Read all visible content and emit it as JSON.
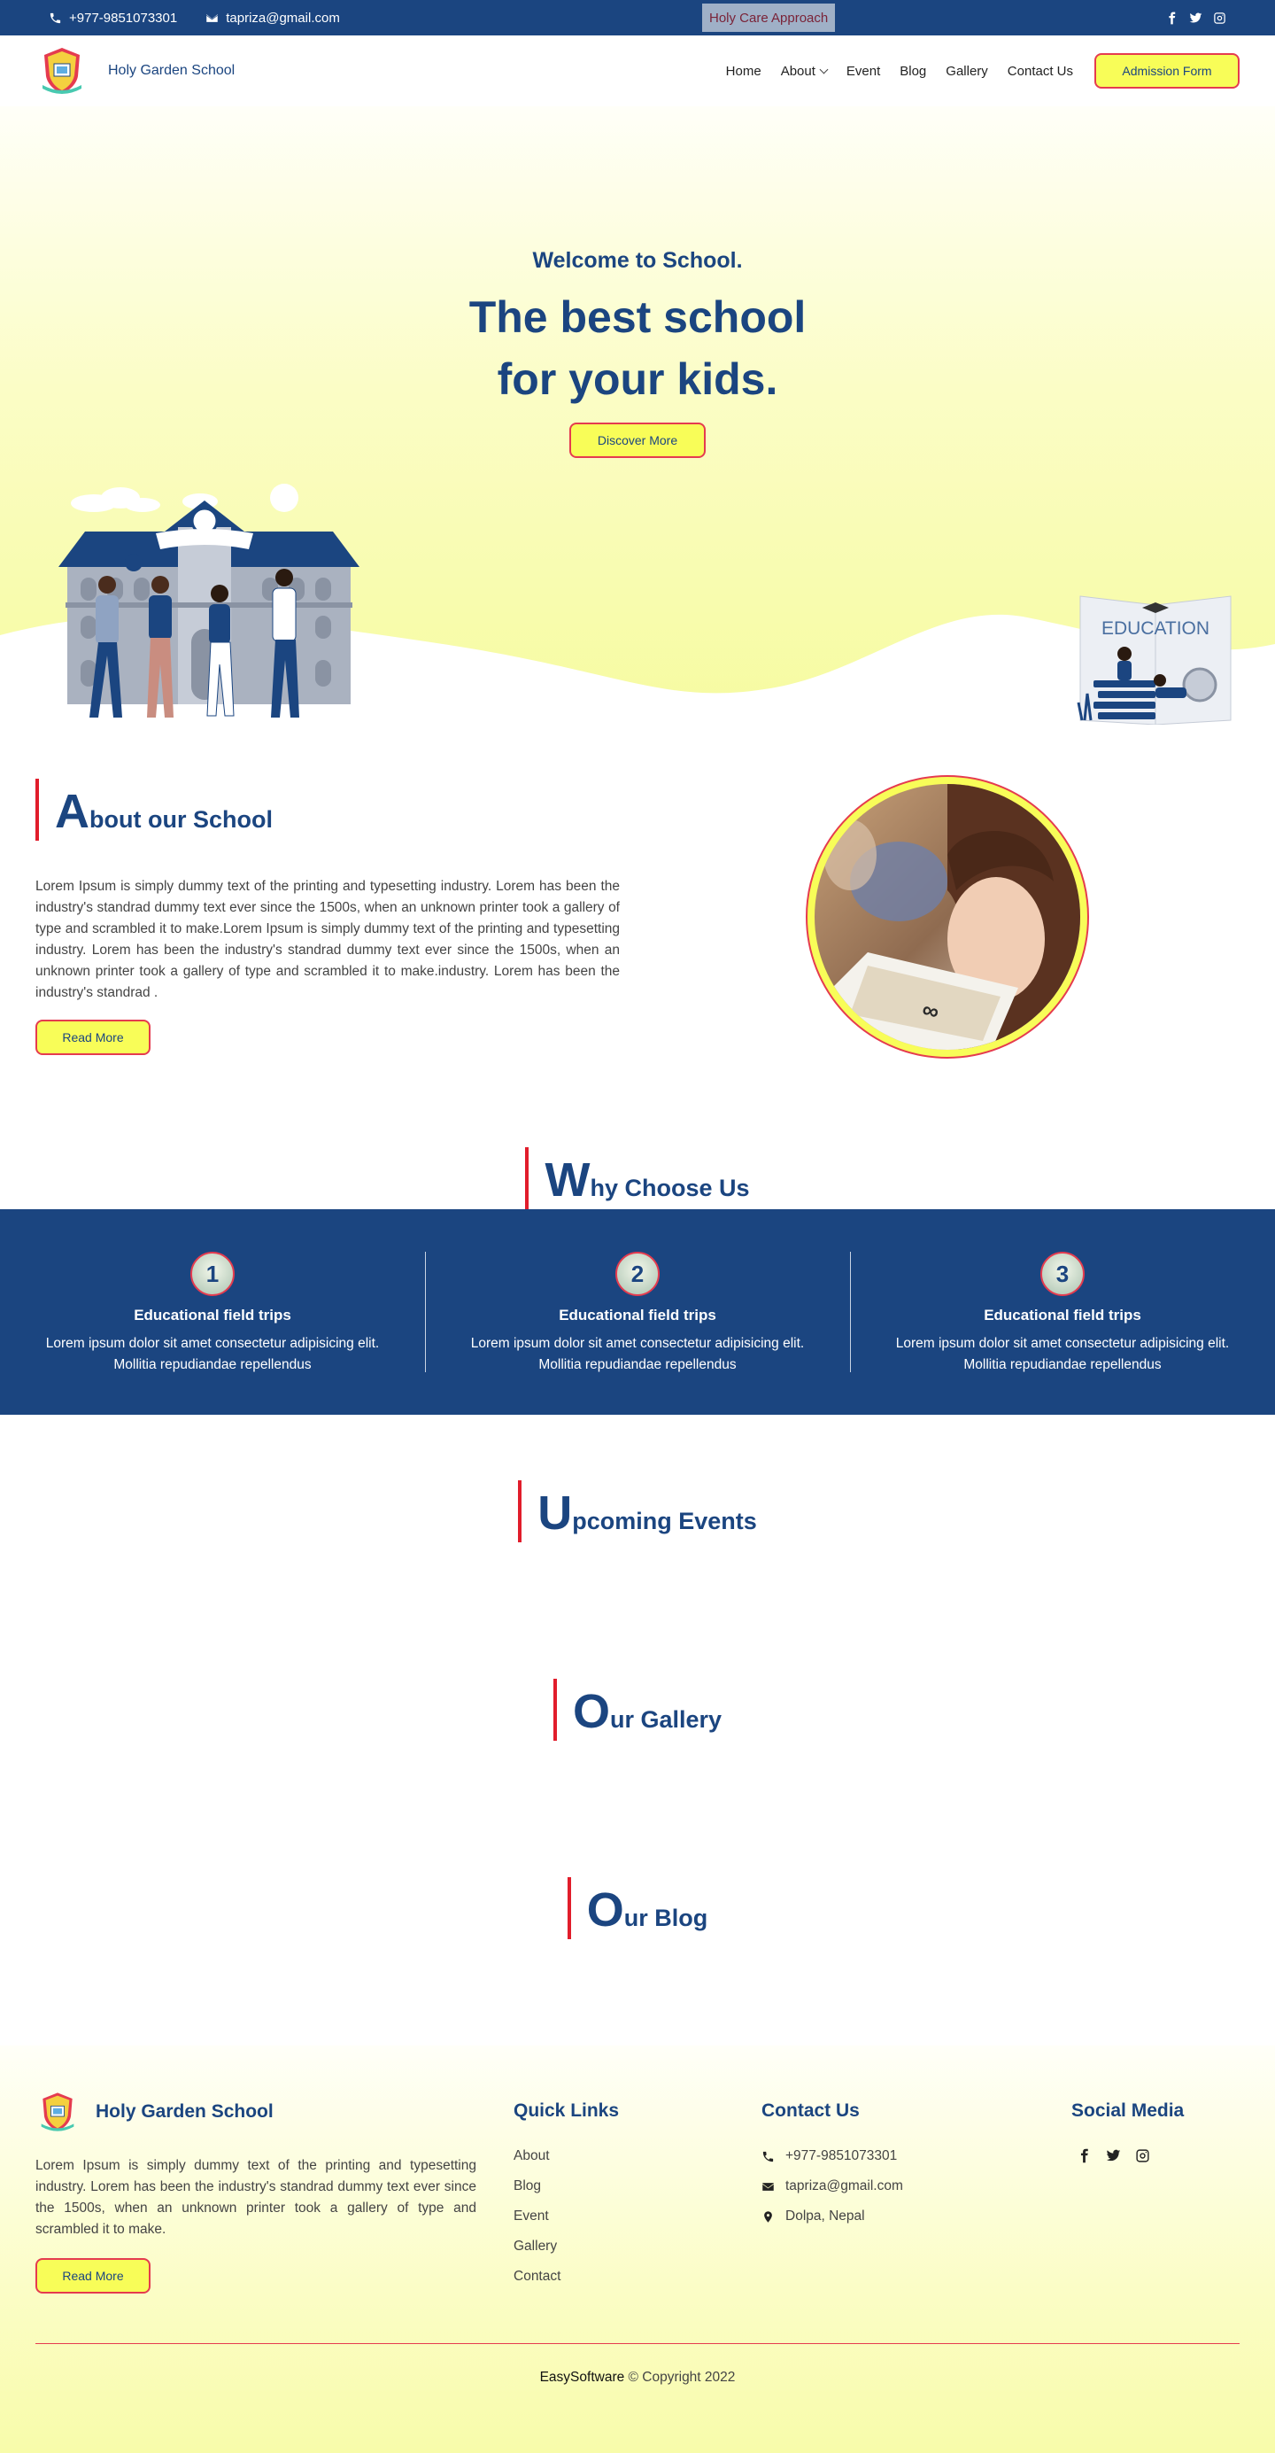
{
  "topbar": {
    "phone": "+977-9851073301",
    "email": "tapriza@gmail.com",
    "badge": "Holy Care Approach",
    "socials": [
      "facebook-icon",
      "twitter-icon",
      "instagram-icon"
    ]
  },
  "header": {
    "brand": "Holy Garden School",
    "nav": {
      "home": "Home",
      "about": "About",
      "event": "Event",
      "blog": "Blog",
      "gallery": "Gallery",
      "contact": "Contact Us"
    },
    "cta": "Admission Form"
  },
  "hero": {
    "welcome": "Welcome to School.",
    "title_line1": "The best school",
    "title_line2": "for your kids.",
    "cta": "Discover More",
    "edu_label": "EDUCATION"
  },
  "about": {
    "heading_cap": "A",
    "heading_rest": "bout our School",
    "text": "Lorem Ipsum is simply dummy text of the printing and typesetting industry. Lorem has been the industry's standrad dummy text ever since the 1500s, when an unknown printer took a gallery of type and scrambled it to make.Lorem Ipsum is simply dummy text of the printing and typesetting industry. Lorem has been the industry's standrad dummy text ever since the 1500s, when an unknown printer took a gallery of type and scrambled it to make.industry. Lorem has been the industry's standrad .",
    "cta": "Read More"
  },
  "why": {
    "heading_cap": "W",
    "heading_rest": "hy Choose Us",
    "items": [
      {
        "num": "1",
        "title": "Educational field trips",
        "line1": "Lorem ipsum dolor sit amet consectetur adipisicing elit.",
        "line2": "Mollitia repudiandae repellendus"
      },
      {
        "num": "2",
        "title": "Educational field trips",
        "line1": "Lorem ipsum dolor sit amet consectetur adipisicing elit.",
        "line2": "Mollitia repudiandae repellendus"
      },
      {
        "num": "3",
        "title": "Educational field trips",
        "line1": "Lorem ipsum dolor sit amet consectetur adipisicing elit.",
        "line2": "Mollitia repudiandae repellendus"
      }
    ]
  },
  "events": {
    "heading_cap": "U",
    "heading_rest": "pcoming Events"
  },
  "gallery": {
    "heading_cap": "O",
    "heading_rest": "ur Gallery"
  },
  "blog": {
    "heading_cap": "O",
    "heading_rest": "ur Blog"
  },
  "footer": {
    "brand": "Holy Garden School",
    "text": "Lorem Ipsum is simply dummy text of the printing and typesetting industry. Lorem has been the industry's standrad dummy text ever since the 1500s, when an unknown printer took a gallery of type and scrambled it to make.",
    "cta": "Read More",
    "quick_links_title": "Quick Links",
    "links": [
      "About",
      "Blog",
      "Event",
      "Gallery",
      "Contact"
    ],
    "contact_title": "Contact Us",
    "phone": "+977-9851073301",
    "email": "tapriza@gmail.com",
    "address": "Dolpa, Nepal",
    "social_title": "Social Media",
    "company": "EasySoftware",
    "copyright": "© Copyright 2022"
  },
  "colors": {
    "navy": "#1b4580",
    "yellow": "#f8fd58",
    "red": "#e53b4f"
  }
}
